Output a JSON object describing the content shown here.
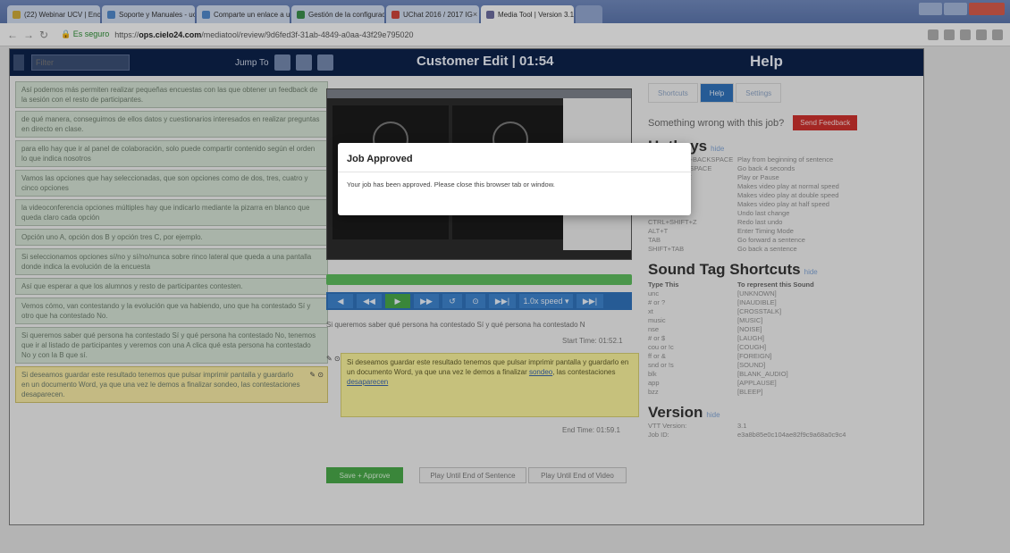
{
  "browser": {
    "tabs": [
      {
        "label": "(22) Webinar UCV | Enc",
        "color": "#c8a63a"
      },
      {
        "label": "Soporte y Manuales - ucv",
        "color": "#4f86c6"
      },
      {
        "label": "Comparte un enlace a un",
        "color": "#4f86c6"
      },
      {
        "label": "Gestión de la configuraci",
        "color": "#3a8a4a"
      },
      {
        "label": "UChat 2016 / 2017 IG",
        "color": "#c8443a"
      },
      {
        "label": "Media Tool | Version 3.1",
        "color": "#6a6a9a"
      }
    ],
    "tab_close": "×",
    "secure_label": "Es seguro",
    "url_prefix": "https://",
    "url_host": "ops.cielo24.com",
    "url_path": "/mediatool/review/9d6fed3f-31ab-4849-a0aa-43f29e795020"
  },
  "header": {
    "filter_placeholder": "Filter",
    "jump_to": "Jump To",
    "title": "Customer Edit | 01:54",
    "help_title": "Help"
  },
  "segments": [
    {
      "text": "Así podemos más permiten realizar pequeñas encuestas con las que obtener un feedback de la sesión con el resto de participantes."
    },
    {
      "text": "de qué manera, conseguimos de ellos datos y cuestionarios interesados en realizar preguntas en directo en clase."
    },
    {
      "text": "para ello hay que ir al panel de colaboración, solo puede compartir contenido según el orden lo que indica nosotros"
    },
    {
      "text": "Vamos las opciones que hay seleccionadas, que son opciones como de dos, tres, cuatro y cinco opciones"
    },
    {
      "text": "la videoconferencia opciones múltiples hay que indicarlo mediante la pizarra en blanco que queda claro cada opción"
    },
    {
      "text": "Opción uno A, opción dos B y opción tres C, por ejemplo."
    },
    {
      "text": "Si seleccionamos opciones sí/no y sí/no/nunca sobre rinco lateral que queda a una pantalla donde indica la evolución de la encuesta"
    },
    {
      "text": "Así que esperar a que los alumnos y resto de participantes contesten."
    },
    {
      "text": "Vemos cómo, van contestando y la evolución que va habiendo, uno que ha contestado Sí y otro que ha contestado No."
    },
    {
      "text": "Si queremos saber qué persona ha contestado Sí y qué persona ha contestado No, tenemos que ir al listado de participantes y veremos con una A clica qué esta persona ha contestado No y con la B que sí."
    },
    {
      "text": "Si deseamos guardar este resultado tenemos que pulsar imprimir pantalla y guardarlo en un documento Word, ya que una vez le demos a finalizar sondeo, las contestaciones desaparecen.",
      "current": true
    }
  ],
  "segment_icons": "✎ ⊙",
  "player": {
    "controls": [
      "◀",
      "◀◀",
      "▶",
      "▶▶",
      "↺",
      "⊙",
      "▶▶|",
      "1.0x speed ▾",
      "▶▶|"
    ]
  },
  "current_line": "Si queremos saber qué persona ha contestado Sí y qué persona ha contestado N",
  "start_time": "Start Time: 01:52.1",
  "editor": {
    "text_a": "Si deseamos guardar este resultado tenemos que pulsar imprimir pantalla y guardarlo en un documento Word, ya que una vez le demos a finalizar ",
    "link_a": "sondeo",
    "text_b": ", las contestaciones ",
    "link_b": "desaparecen"
  },
  "end_time": "End Time: 01:59.1",
  "buttons": {
    "save": "Save + Approve",
    "play_end_sentence": "Play Until End of Sentence",
    "play_end_video": "Play Until End of Video"
  },
  "help": {
    "tabs": [
      "Shortcuts",
      "Help",
      "Settings"
    ],
    "active_tab": 1,
    "wrong_text": "Something wrong with this job?",
    "feedback_button": "Send Feedback",
    "hotkeys_title": "Hotkeys",
    "hide": "hide",
    "hotkeys": [
      {
        "k": "CTRL+SHIFT+BACKSPACE",
        "v": "Play from beginning of sentence"
      },
      {
        "k": "SHIFT+BACKSPACE",
        "v": "Go back 4 seconds"
      },
      {
        "k": "CTRL+SPACE",
        "v": "Play or Pause"
      },
      {
        "k": "CTRL+1",
        "v": "Makes video play at normal speed"
      },
      {
        "k": "CTRL+2",
        "v": "Makes video play at double speed"
      },
      {
        "k": "CTRL+3",
        "v": "Makes video play at half speed"
      },
      {
        "k": "CTRL+Z",
        "v": "Undo last change"
      },
      {
        "k": "CTRL+SHIFT+Z",
        "v": "Redo last undo"
      },
      {
        "k": "ALT+T",
        "v": "Enter Timing Mode"
      },
      {
        "k": "TAB",
        "v": "Go forward a sentence"
      },
      {
        "k": "SHIFT+TAB",
        "v": "Go back a sentence"
      }
    ],
    "sound_title": "Sound Tag Shortcuts",
    "sound_header": {
      "k": "Type This",
      "v": "To represent this Sound"
    },
    "sound_tags": [
      {
        "k": "unc",
        "v": "[UNKNOWN]"
      },
      {
        "k": "# or ?",
        "v": "[INAUDIBLE]"
      },
      {
        "k": "xt",
        "v": "[CROSSTALK]"
      },
      {
        "k": "music",
        "v": "[MUSIC]"
      },
      {
        "k": "nse",
        "v": "[NOISE]"
      },
      {
        "k": "# or $",
        "v": "[LAUGH]"
      },
      {
        "k": "cou or !c",
        "v": "[COUGH]"
      },
      {
        "k": "ff or &",
        "v": "[FOREIGN]"
      },
      {
        "k": "snd or !s",
        "v": "[SOUND]"
      },
      {
        "k": "blk",
        "v": "[BLANK_AUDIO]"
      },
      {
        "k": "app",
        "v": "[APPLAUSE]"
      },
      {
        "k": "bzz",
        "v": "[BLEEP]"
      }
    ],
    "version_title": "Version",
    "version_rows": [
      {
        "k": "VTT Version:",
        "v": "3.1"
      },
      {
        "k": "Job ID:",
        "v": "e3a8b85e0c104ae82f9c9a68a0c9c4"
      }
    ]
  },
  "modal": {
    "title": "Job Approved",
    "body": "Your job has been approved. Please close this browser tab or window."
  }
}
